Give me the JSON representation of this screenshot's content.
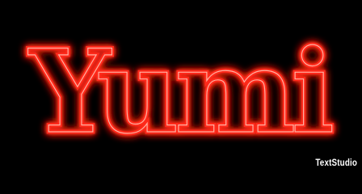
{
  "artwork": {
    "text": "Yumi",
    "style": "neon outline",
    "stroke_color": "#ff2a1a",
    "glow_color": "#ff0000",
    "core_color": "#ffb0a0",
    "background_color": "#000000"
  },
  "watermark": {
    "text": "TextStudio",
    "color": "#ffffff"
  }
}
